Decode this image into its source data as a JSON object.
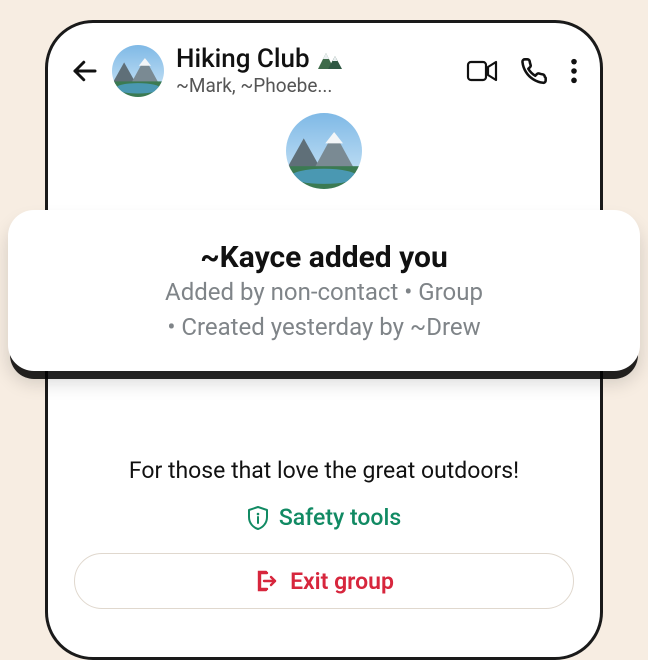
{
  "header": {
    "title": "Hiking Club",
    "emoji": "⛰️",
    "subtitle": "~Mark, ~Phoebe..."
  },
  "context_card": {
    "title": "~Kayce added you",
    "line1": "Added by non-contact • Group",
    "line2": "• Created yesterday by ~Drew"
  },
  "description": "For those that love the great outdoors!",
  "safety_label": "Safety tools",
  "exit_label": "Exit group",
  "colors": {
    "accent_green": "#118a63",
    "accent_red": "#d7263d"
  }
}
